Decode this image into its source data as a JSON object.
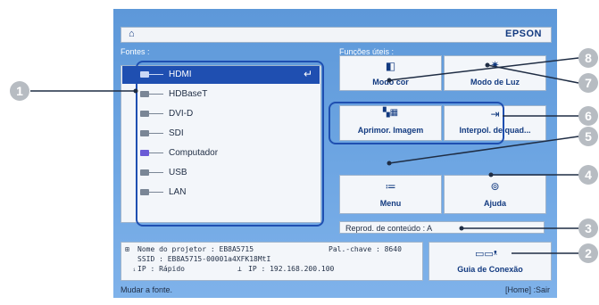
{
  "header": {
    "brand": "EPSON",
    "home_icon": "home-icon"
  },
  "sources": {
    "label": "Fontes :",
    "items": [
      {
        "label": "HDMI",
        "selected": true
      },
      {
        "label": "HDBaseT",
        "selected": false
      },
      {
        "label": "DVI-D",
        "selected": false
      },
      {
        "label": "SDI",
        "selected": false
      },
      {
        "label": "Computador",
        "selected": false
      },
      {
        "label": "USB",
        "selected": false
      },
      {
        "label": "LAN",
        "selected": false
      }
    ],
    "enter_glyph": "↵"
  },
  "functions": {
    "label": "Funções úteis :",
    "tiles": [
      {
        "label": "Modo cor",
        "icon": "color-mode-icon"
      },
      {
        "label": "Modo de Luz",
        "icon": "light-mode-icon"
      },
      {
        "label": "Aprimor. Imagem",
        "icon": "image-enhancement-icon"
      },
      {
        "label": "Interpol. de quad...",
        "icon": "frame-interpolation-icon"
      },
      {
        "label": "Menu",
        "icon": "menu-icon"
      },
      {
        "label": "Ajuda",
        "icon": "help-icon"
      }
    ],
    "content_playback": "Reprod. de conteúdo  :  A"
  },
  "info": {
    "projector_name": "Nome do projetor : EB8A5715",
    "keyword": "Pal.-chave : 8640",
    "ssid": "SSID : EB8A5715-00001a4XFK18MtI",
    "ip_wireless": "IP : Rápido",
    "ip_wired": "IP : 192.168.200.100"
  },
  "connection_guide": {
    "label": "Guia de Conexão",
    "icon": "connection-guide-icon"
  },
  "statusbar": {
    "left": "Mudar a fonte.",
    "right": "[Home] :Sair"
  },
  "callouts": [
    "1",
    "2",
    "3",
    "4",
    "5",
    "6",
    "7",
    "8"
  ],
  "colors": {
    "screen_blue": "#6ea6e3",
    "selected_blue": "#1f4fb1",
    "text_navy": "#123a80",
    "callout_gray": "#b7bcc2"
  }
}
